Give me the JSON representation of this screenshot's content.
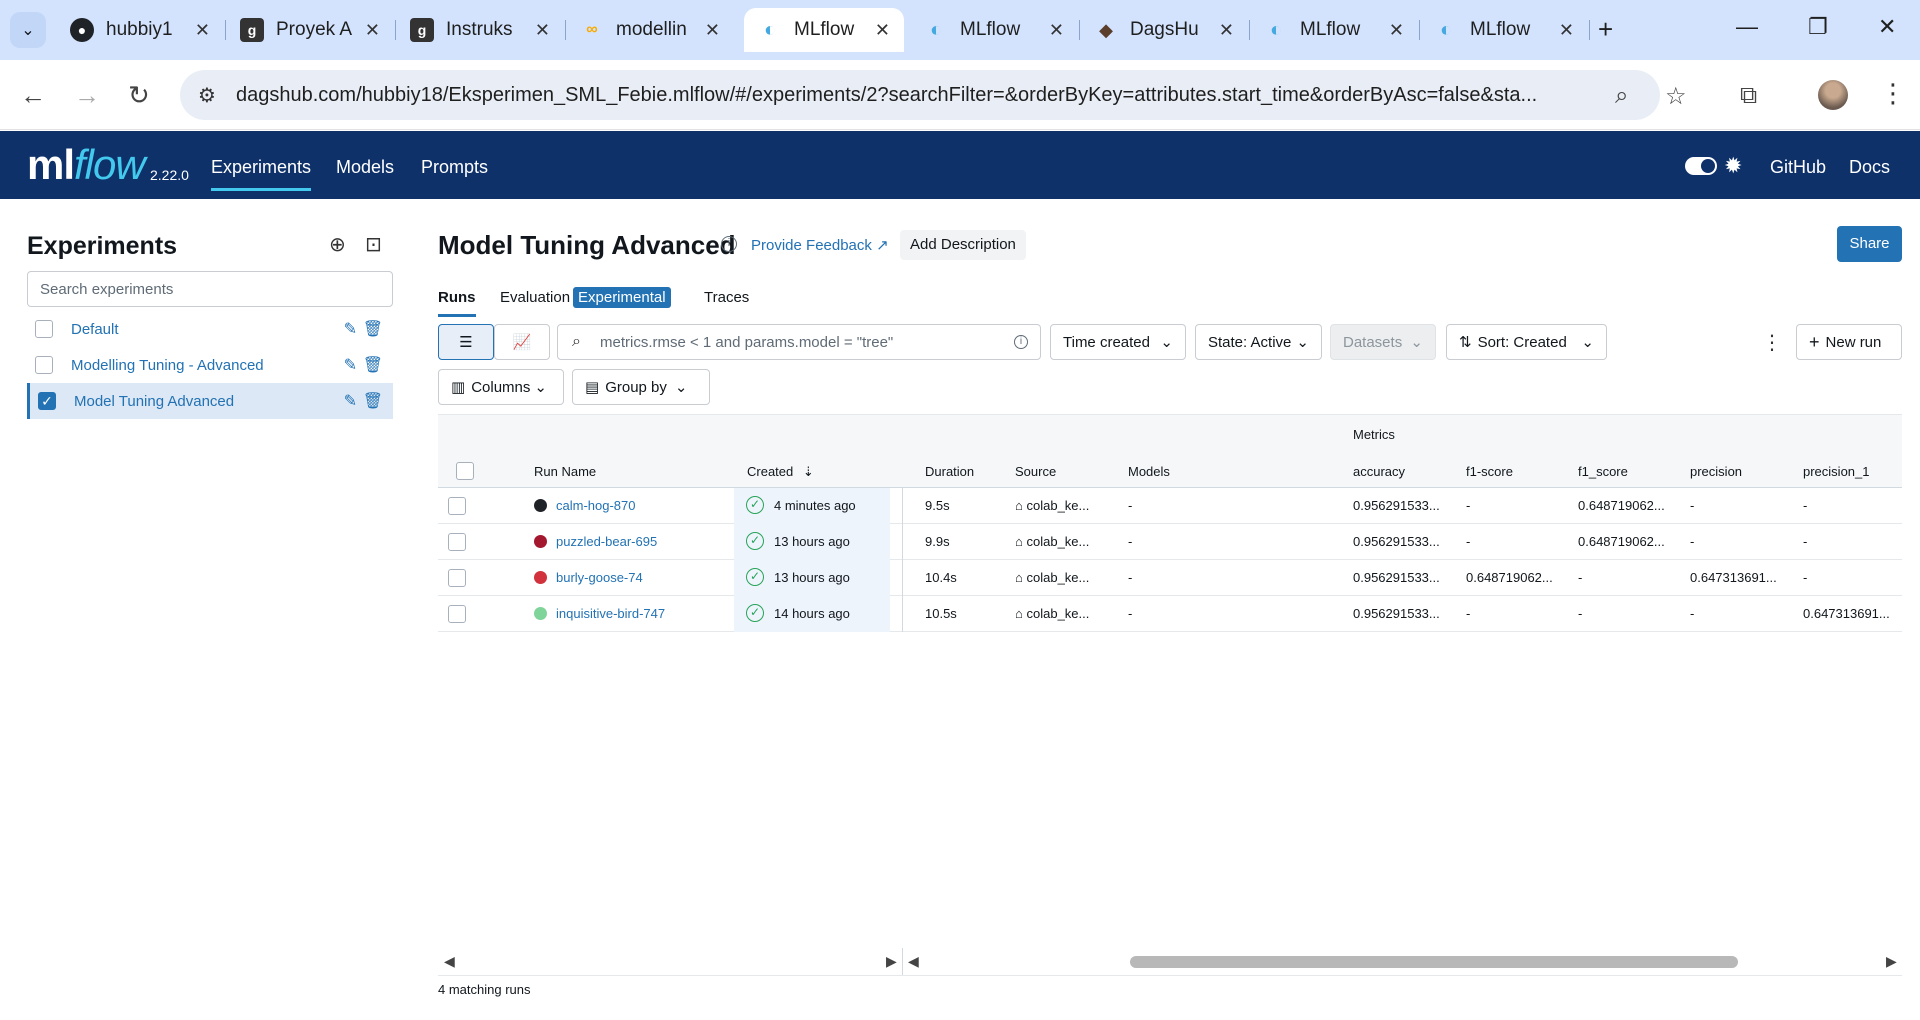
{
  "browser": {
    "tabs": [
      {
        "label": "hubbiy1",
        "icon": "github-icon"
      },
      {
        "label": "Proyek A",
        "icon": "g-icon"
      },
      {
        "label": "Instruks",
        "icon": "g-icon"
      },
      {
        "label": "modellin",
        "icon": "colab-icon"
      },
      {
        "label": "MLflow",
        "icon": "mlflow-icon"
      },
      {
        "label": "MLflow",
        "icon": "mlflow-icon"
      },
      {
        "label": "DagsHu",
        "icon": "dagshub-icon"
      },
      {
        "label": "MLflow",
        "icon": "mlflow-icon"
      },
      {
        "label": "MLflow",
        "icon": "mlflow-icon"
      }
    ],
    "url": "dagshub.com/hubbiy18/Eksperimen_SML_Febie.mlflow/#/experiments/2?searchFilter=&orderByKey=attributes.start_time&orderByAsc=false&sta..."
  },
  "header": {
    "logo_ml": "ml",
    "logo_flow": "flow",
    "version": "2.22.0",
    "nav": [
      "Experiments",
      "Models",
      "Prompts"
    ],
    "links": [
      "GitHub",
      "Docs"
    ]
  },
  "sidebar": {
    "title": "Experiments",
    "search_placeholder": "Search experiments",
    "items": [
      {
        "label": "Default",
        "checked": false
      },
      {
        "label": "Modelling Tuning - Advanced",
        "checked": false
      },
      {
        "label": "Model Tuning Advanced",
        "checked": true
      }
    ]
  },
  "main": {
    "title": "Model Tuning Advanced",
    "feedback": "Provide Feedback",
    "add_description": "Add Description",
    "share": "Share",
    "tabs": [
      "Runs",
      "Evaluation",
      "Experimental",
      "Traces"
    ],
    "search_placeholder": "metrics.rmse < 1 and params.model = \"tree\"",
    "filters": {
      "time": "Time created",
      "state": "State: Active",
      "datasets": "Datasets",
      "sort": "Sort: Created",
      "new_run": "New run",
      "columns": "Columns",
      "group_by": "Group by"
    },
    "table": {
      "group_header": "Metrics",
      "headers": [
        "Run Name",
        "Created",
        "Duration",
        "Source",
        "Models",
        "accuracy",
        "f1-score",
        "f1_score",
        "precision",
        "precision_1"
      ],
      "rows": [
        {
          "color": "#1f2328",
          "name": "calm-hog-870",
          "created": "4 minutes ago",
          "duration": "9.5s",
          "source": "colab_ke...",
          "models": "-",
          "accuracy": "0.956291533...",
          "f1dash": "-",
          "f1under": "0.648719062...",
          "precision": "-",
          "precision_1": "-"
        },
        {
          "color": "#a3172f",
          "name": "puzzled-bear-695",
          "created": "13 hours ago",
          "duration": "9.9s",
          "source": "colab_ke...",
          "models": "-",
          "accuracy": "0.956291533...",
          "f1dash": "-",
          "f1under": "0.648719062...",
          "precision": "-",
          "precision_1": "-"
        },
        {
          "color": "#d1323b",
          "name": "burly-goose-74",
          "created": "13 hours ago",
          "duration": "10.4s",
          "source": "colab_ke...",
          "models": "-",
          "accuracy": "0.956291533...",
          "f1dash": "0.648719062...",
          "f1under": "-",
          "precision": "0.647313691...",
          "precision_1": "-"
        },
        {
          "color": "#7fd49a",
          "name": "inquisitive-bird-747",
          "created": "14 hours ago",
          "duration": "10.5s",
          "source": "colab_ke...",
          "models": "-",
          "accuracy": "0.956291533...",
          "f1dash": "-",
          "f1under": "-",
          "precision": "-",
          "precision_1": "0.647313691..."
        }
      ]
    },
    "footer": "4 matching runs"
  }
}
